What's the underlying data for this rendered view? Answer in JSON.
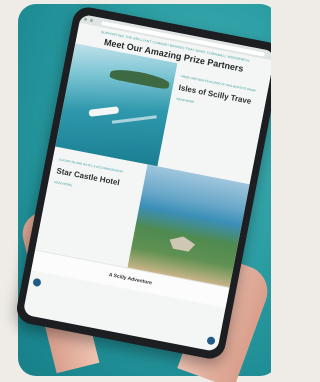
{
  "page": {
    "tagline": "Supporting the Brilliant Cornish Brands that make Cornwall Wonderful",
    "title": "Meet Our Amazing Prize Partners"
  },
  "partners": [
    {
      "kicker": "Prize Partner Featured in this Month's Draw",
      "name": "Isles of Scilly Trave",
      "more": "Read More"
    },
    {
      "kicker": "Luxury Island Hotel & Accommodation",
      "name": "Star Castle Hotel",
      "more": "Read More"
    }
  ],
  "footer": {
    "label": "A Scilly Adventure"
  }
}
